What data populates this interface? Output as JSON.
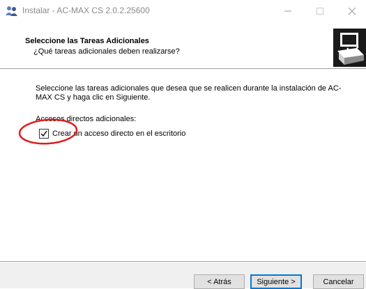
{
  "window": {
    "title": "Instalar - AC-MAX CS 2.0.2.25600",
    "icons": {
      "app": "installer-users-icon",
      "minimize": "minimize-icon",
      "maximize": "maximize-icon",
      "close": "close-icon"
    }
  },
  "header": {
    "title": "Seleccione las Tareas Adicionales",
    "subtitle": "¿Qué tareas adicionales deben realizarse?",
    "image_icon": "computer-box-icon"
  },
  "body": {
    "description": "Seleccione las tareas adicionales que desea que se realicen durante la instalación de AC-MAX CS y haga clic en Siguiente.",
    "group_label": "Accesos directos adicionales:",
    "tasks": [
      {
        "label": "Crear un acceso directo en el escritorio",
        "checked": true
      }
    ]
  },
  "annotation": {
    "color": "#e21b1b",
    "shape": "ellipse"
  },
  "footer": {
    "back_label": "< Atrás",
    "next_label": "Siguiente >",
    "cancel_label": "Cancelar"
  },
  "colors": {
    "footer_bg": "#f0f0f0",
    "focus_border": "#0078d7",
    "title_text": "#8a8a8a"
  }
}
